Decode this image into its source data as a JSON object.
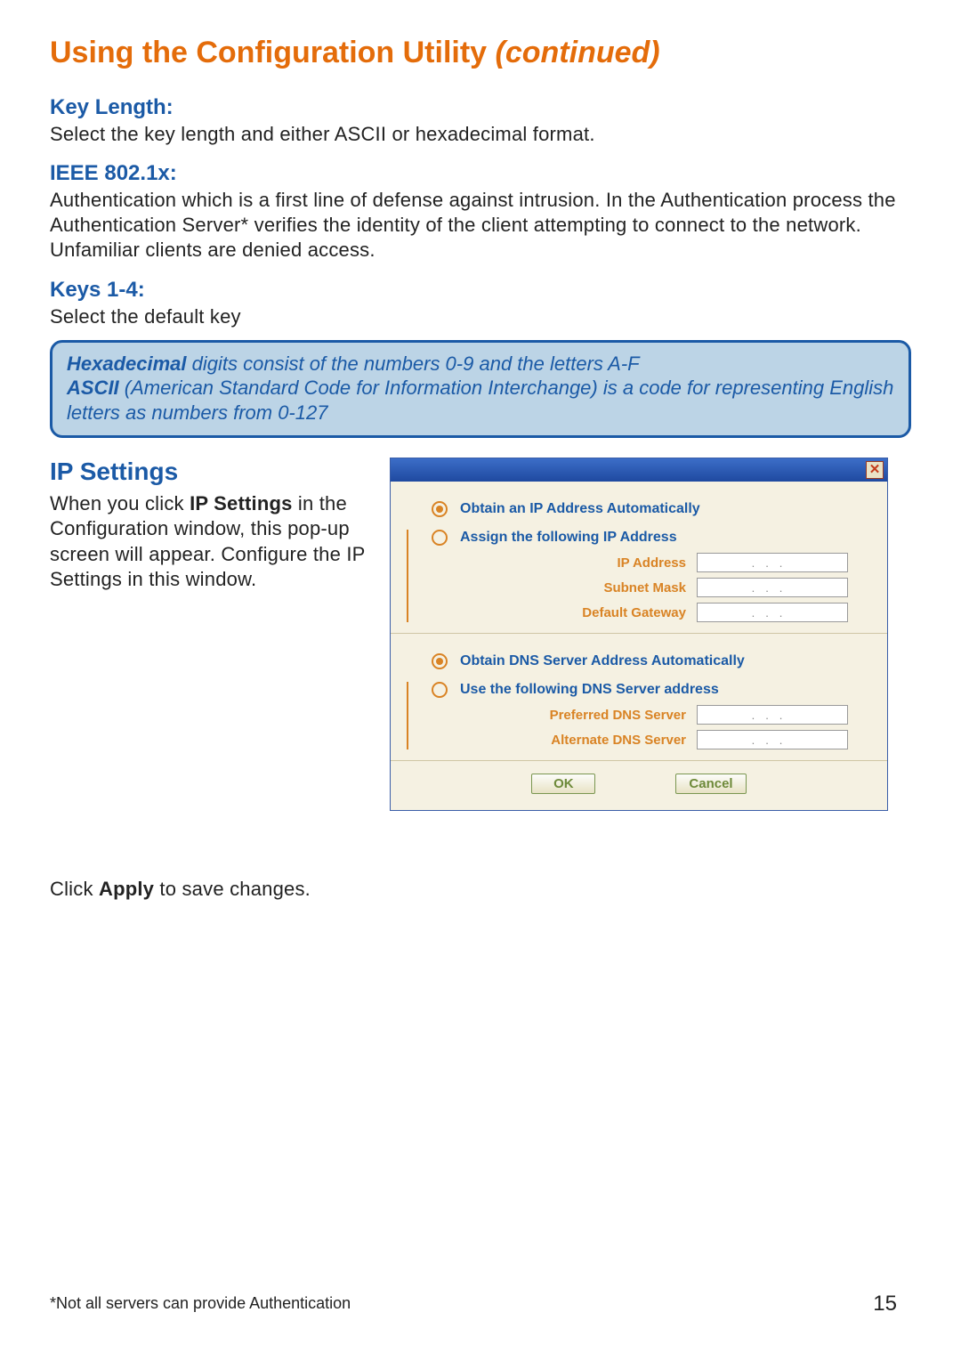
{
  "title_main": "Using the Configuration Utility ",
  "title_cont": "(continued)",
  "sections": {
    "key_length": {
      "label": "Key Length:",
      "text": "Select the key length and either ASCII or hexadecimal format."
    },
    "ieee": {
      "label": "IEEE 802.1x:",
      "text": "Authentication which is a first line of defense against intrusion. In the Authentication process the Authentication Server* verifies the identity of the client attempting to connect to the network. Unfamiliar clients are denied access."
    },
    "keys14": {
      "label": "Keys 1-4:",
      "text": "Select the default key"
    }
  },
  "infobox": {
    "hex_term": "Hexadecimal",
    "hex_rest": " digits consist of the numbers 0-9 and the letters A-F",
    "ascii_term": "ASCII",
    "ascii_rest": " (American Standard Code for Information Interchange) is a code for representing English letters as numbers from 0-127"
  },
  "ip": {
    "heading": "IP Settings",
    "intro_pre": "When you click ",
    "intro_bold": "IP Settings",
    "intro_post": " in the Configuration window, this pop-up screen will appear. Configure the IP Settings in this window.",
    "apply_pre": "Click ",
    "apply_bold": "Apply",
    "apply_post": " to save changes."
  },
  "dialog": {
    "close_glyph": "✕",
    "ip_auto": "Obtain an IP Address Automatically",
    "ip_manual": "Assign the following IP Address",
    "ip_address": "IP Address",
    "subnet": "Subnet Mask",
    "gateway": "Default Gateway",
    "dns_auto": "Obtain DNS Server Address Automatically",
    "dns_manual": "Use the following DNS Server address",
    "pref_dns": "Preferred DNS Server",
    "alt_dns": "Alternate DNS Server",
    "ip_placeholder": "...",
    "ok": "OK",
    "cancel": "Cancel"
  },
  "footnote": "*Not all servers can provide Authentication",
  "page_number": "15"
}
